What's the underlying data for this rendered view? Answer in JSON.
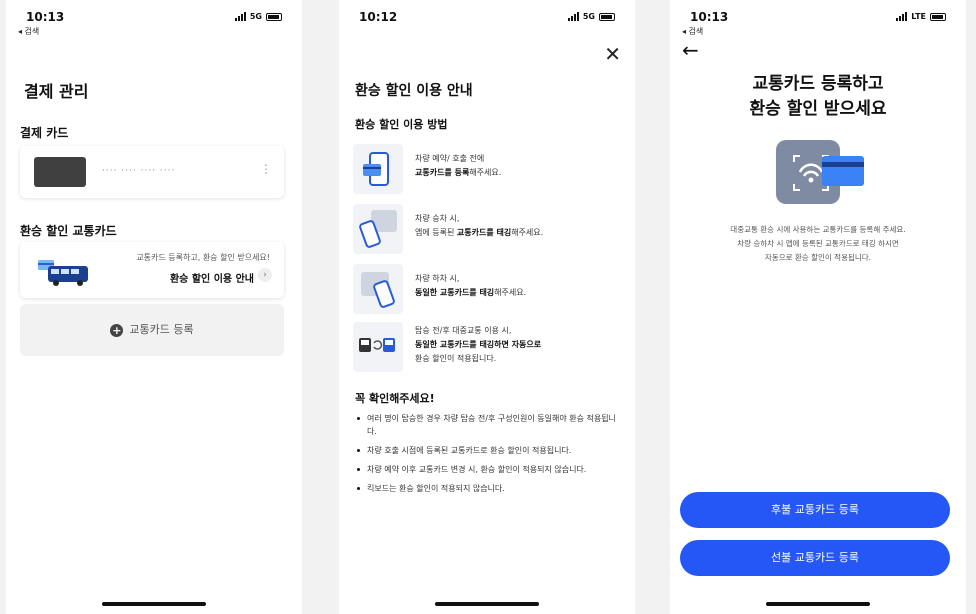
{
  "screen1": {
    "status": {
      "time": "10:13",
      "back": "◂ 검색",
      "network": "5G"
    },
    "title": "결제 관리",
    "payment_card_section": "결제 카드",
    "card_number": "···· ···· ···· ····",
    "discount_section": "환승 할인 교통카드",
    "promo_desc": "교통카드 등록하고, 환승 할인 받으세요!",
    "promo_link": "환승 할인 이용 안내",
    "add_card_label": "교통카드 등록"
  },
  "screen2": {
    "status": {
      "time": "10:12",
      "network": "5G"
    },
    "title": "환승 할인 이용 안내",
    "subtitle": "환승 할인 이용 방법",
    "steps": [
      {
        "line1": "차량 예약/ 호출 전에",
        "line2_bold": "교통카드를 등록",
        "line2_rest": "해주세요."
      },
      {
        "line1": "차량 승차 시,",
        "line2_pre": "앱에 등록된 ",
        "line2_bold": "교통카드를 태깅",
        "line2_rest": "해주세요."
      },
      {
        "line1": "차량 하차 시,",
        "line2_bold": "동일한 교통카드를 태깅",
        "line2_rest": "해주세요."
      },
      {
        "line1": "탑승 전/후 대중교통 이용 시,",
        "line2_bold": "동일한 교통카드를 태깅하면 자동으로",
        "line3": "환승 할인이 적용됩니다."
      }
    ],
    "warning_title": "꼭 확인해주세요!",
    "bullets": [
      "여러 명이 탑승한 경우 차량 탑승 전/후 구성인원이 동일해야 환승 적용됩니다.",
      "차량 호출 시점에 등록된 교통카드로 환승 할인이 적용됩니다.",
      "차량 예약 이후 교통카드 변경 시, 환승 할인이 적용되지 않습니다.",
      "킥보드는 환승 할인이 적용되지 않습니다."
    ]
  },
  "screen3": {
    "status": {
      "time": "10:13",
      "back": "◂ 검색",
      "network": "LTE"
    },
    "title_line1": "교통카드 등록하고",
    "title_line2": "환승 할인 받으세요",
    "desc_line1": "대중교통 환승 시에 사용하는 교통카드를 등록해 주세요.",
    "desc_line2": "차량 승하차 시 앱에 등록된 교통카드로 태깅 하시면",
    "desc_line3": "자동으로 환승 할인이 적용됩니다.",
    "postpaid_button": "후불 교통카드 등록",
    "prepaid_button": "선불 교통카드 등록"
  },
  "colors": {
    "accent": "#2457f5",
    "card_blue": "#3b82f6"
  }
}
